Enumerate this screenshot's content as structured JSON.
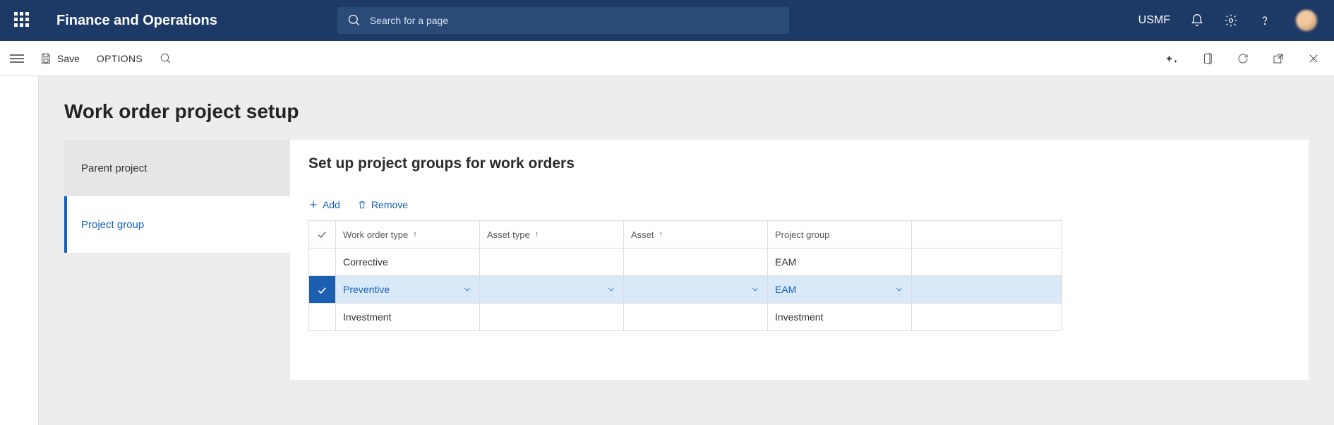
{
  "nav": {
    "brand": "Finance and Operations",
    "search_placeholder": "Search for a page",
    "entity": "USMF"
  },
  "action_bar": {
    "save_label": "Save",
    "options_label": "OPTIONS"
  },
  "page": {
    "title": "Work order project setup"
  },
  "tabs": {
    "items": [
      {
        "label": "Parent project",
        "active": false
      },
      {
        "label": "Project group",
        "active": true
      }
    ]
  },
  "main": {
    "heading": "Set up project groups for work orders",
    "actions": {
      "add_label": "Add",
      "remove_label": "Remove"
    },
    "columns": {
      "work_order_type": "Work order type",
      "asset_type": "Asset type",
      "asset": "Asset",
      "project_group": "Project group"
    },
    "rows": [
      {
        "work_order_type": "Corrective",
        "asset_type": "",
        "asset": "",
        "project_group": "EAM",
        "selected": false
      },
      {
        "work_order_type": "Preventive",
        "asset_type": "",
        "asset": "",
        "project_group": "EAM",
        "selected": true
      },
      {
        "work_order_type": "Investment",
        "asset_type": "",
        "asset": "",
        "project_group": "Investment",
        "selected": false
      }
    ]
  }
}
